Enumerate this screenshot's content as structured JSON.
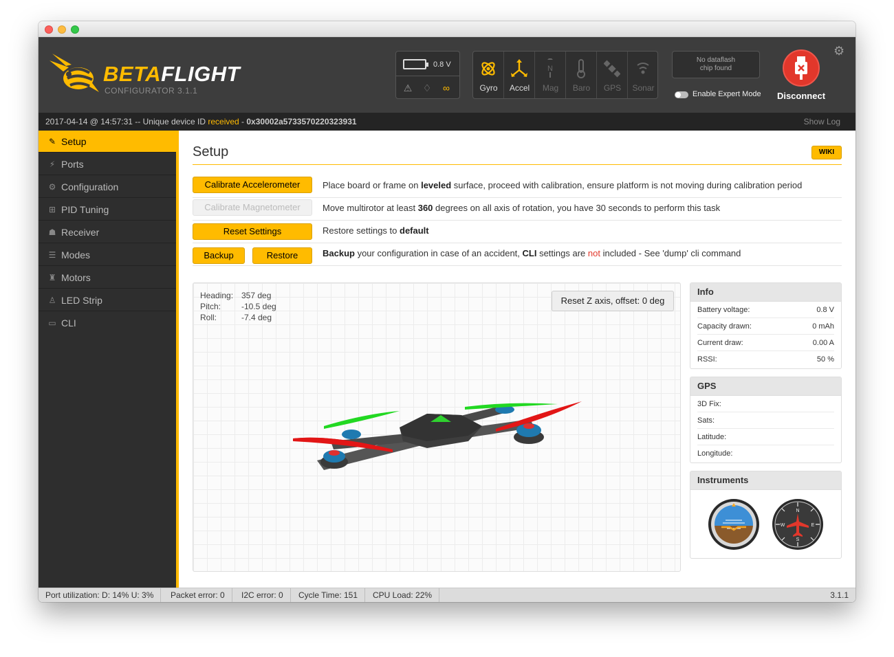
{
  "app": {
    "name_part1": "BETA",
    "name_part2": "FLIGHT",
    "subtitle": "CONFIGURATOR  3.1.1"
  },
  "header": {
    "battery_voltage": "0.8 V",
    "sensors": [
      {
        "label": "Gyro",
        "active": true
      },
      {
        "label": "Accel",
        "active": true
      },
      {
        "label": "Mag",
        "active": false
      },
      {
        "label": "Baro",
        "active": false
      },
      {
        "label": "GPS",
        "active": false
      },
      {
        "label": "Sonar",
        "active": false
      }
    ],
    "dataflash_line1": "No dataflash",
    "dataflash_line2": "chip found",
    "expert_mode_label": "Enable Expert Mode",
    "disconnect_label": "Disconnect"
  },
  "log": {
    "timestamp": "2017-04-14 @ 14:57:31",
    "prefix": " -- Unique device ID ",
    "status": "received",
    "sep": " - ",
    "device_id": "0x30002a5733570220323931",
    "show_log": "Show Log"
  },
  "sidebar": {
    "items": [
      {
        "label": "Setup",
        "icon": "wrench-icon",
        "glyph": "✎"
      },
      {
        "label": "Ports",
        "icon": "plug-icon",
        "glyph": "⚡"
      },
      {
        "label": "Configuration",
        "icon": "gear-icon",
        "glyph": "⚙"
      },
      {
        "label": "PID Tuning",
        "icon": "sitemap-icon",
        "glyph": "⊞"
      },
      {
        "label": "Receiver",
        "icon": "gamepad-icon",
        "glyph": "☗"
      },
      {
        "label": "Modes",
        "icon": "toggle-icon",
        "glyph": "☰"
      },
      {
        "label": "Motors",
        "icon": "motor-icon",
        "glyph": "♜"
      },
      {
        "label": "LED Strip",
        "icon": "led-icon",
        "glyph": "♙"
      },
      {
        "label": "CLI",
        "icon": "terminal-icon",
        "glyph": "▭"
      }
    ]
  },
  "setup": {
    "title": "Setup",
    "wiki": "WIKI",
    "calibrate_acc": {
      "button": "Calibrate Accelerometer",
      "t1": "Place board or frame on ",
      "b1": "leveled",
      "t2": " surface, proceed with calibration, ensure platform is not moving during calibration period"
    },
    "calibrate_mag": {
      "button": "Calibrate Magnetometer",
      "t1": "Move multirotor at least ",
      "b1": "360",
      "t2": " degrees on all axis of rotation, you have 30 seconds to perform this task"
    },
    "reset": {
      "button": "Reset Settings",
      "t1": "Restore settings to ",
      "b1": "default"
    },
    "backup": {
      "backup_button": "Backup",
      "restore_button": "Restore",
      "b1": "Backup",
      "t1": " your configuration in case of an accident, ",
      "b2": "CLI",
      "t2": " settings are ",
      "red": "not",
      "t3": " included - See 'dump' cli command"
    },
    "attitude": {
      "heading_label": "Heading:",
      "heading_value": "357 deg",
      "pitch_label": "Pitch:",
      "pitch_value": "-10.5 deg",
      "roll_label": "Roll:",
      "roll_value": "-7.4 deg"
    },
    "reset_z": "Reset Z axis, offset: 0 deg"
  },
  "info": {
    "title": "Info",
    "rows": [
      {
        "k": "Battery voltage:",
        "v": "0.8 V"
      },
      {
        "k": "Capacity drawn:",
        "v": "0 mAh"
      },
      {
        "k": "Current draw:",
        "v": "0.00 A"
      },
      {
        "k": "RSSI:",
        "v": "50 %"
      }
    ]
  },
  "gps": {
    "title": "GPS",
    "rows": [
      {
        "k": "3D Fix:",
        "v": ""
      },
      {
        "k": "Sats:",
        "v": ""
      },
      {
        "k": "Latitude:",
        "v": ""
      },
      {
        "k": "Longitude:",
        "v": ""
      }
    ]
  },
  "instruments": {
    "title": "Instruments"
  },
  "statusbar": {
    "port": "Port utilization: D: 14% U: 3%",
    "packet": "Packet error: 0",
    "i2c": "I2C error: 0",
    "cycle": "Cycle Time: 151",
    "cpu": "CPU Load: 22%",
    "version": "3.1.1"
  },
  "colors": {
    "accent": "#ffbb00",
    "header_bg": "#3d3d3d",
    "sidebar_bg": "#2e2e2e",
    "disconnect": "#e2372b"
  }
}
